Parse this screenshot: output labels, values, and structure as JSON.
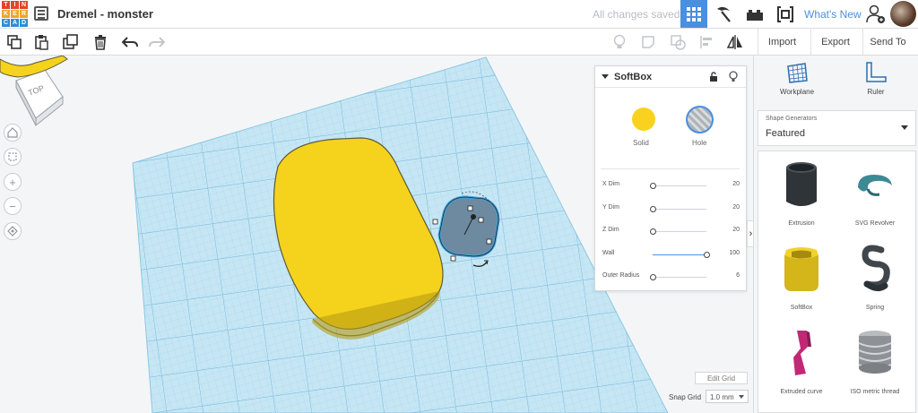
{
  "app": {
    "logo_letters": [
      "T",
      "I",
      "N",
      "K",
      "E",
      "R",
      "C",
      "A",
      "D"
    ],
    "logo_colors": [
      "#e5432c",
      "#e5432c",
      "#e5432c",
      "#f0a42a",
      "#f0a42a",
      "#f0a42a",
      "#2f8cd6",
      "#2f8cd6",
      "#2f8cd6"
    ],
    "design_title": "Dremel - monster",
    "save_status": "All changes saved",
    "whats_new": "What's New",
    "accent_color": "#4a8fe0"
  },
  "toolbar": {
    "import_label": "Import",
    "export_label": "Export",
    "send_to_label": "Send To"
  },
  "viewcube": {
    "label": "TOP"
  },
  "inspector": {
    "shape_name": "SoftBox",
    "solid_label": "Solid",
    "hole_label": "Hole",
    "solid_color": "#f9d21f",
    "properties": [
      {
        "label": "X Dim",
        "value": "20",
        "level": 0.0
      },
      {
        "label": "Y Dim",
        "value": "20",
        "level": 0.0
      },
      {
        "label": "Z Dim",
        "value": "20",
        "level": 0.0
      },
      {
        "label": "Wall",
        "value": "100",
        "level": 1.0
      },
      {
        "label": "Outer Radius",
        "value": "6",
        "level": 0.0
      }
    ]
  },
  "right_panel": {
    "workplane_label": "Workplane",
    "ruler_label": "Ruler",
    "generators_header": "Shape Generators",
    "generators_value": "Featured",
    "shapes": [
      "Extrusion",
      "SVG Revolver",
      "SoftBox",
      "Spring",
      "Extruded curve",
      "ISO metric thread"
    ]
  },
  "grid_controls": {
    "edit_grid_label": "Edit Grid",
    "snap_grid_label": "Snap Grid",
    "snap_grid_value": "1.0 mm"
  }
}
